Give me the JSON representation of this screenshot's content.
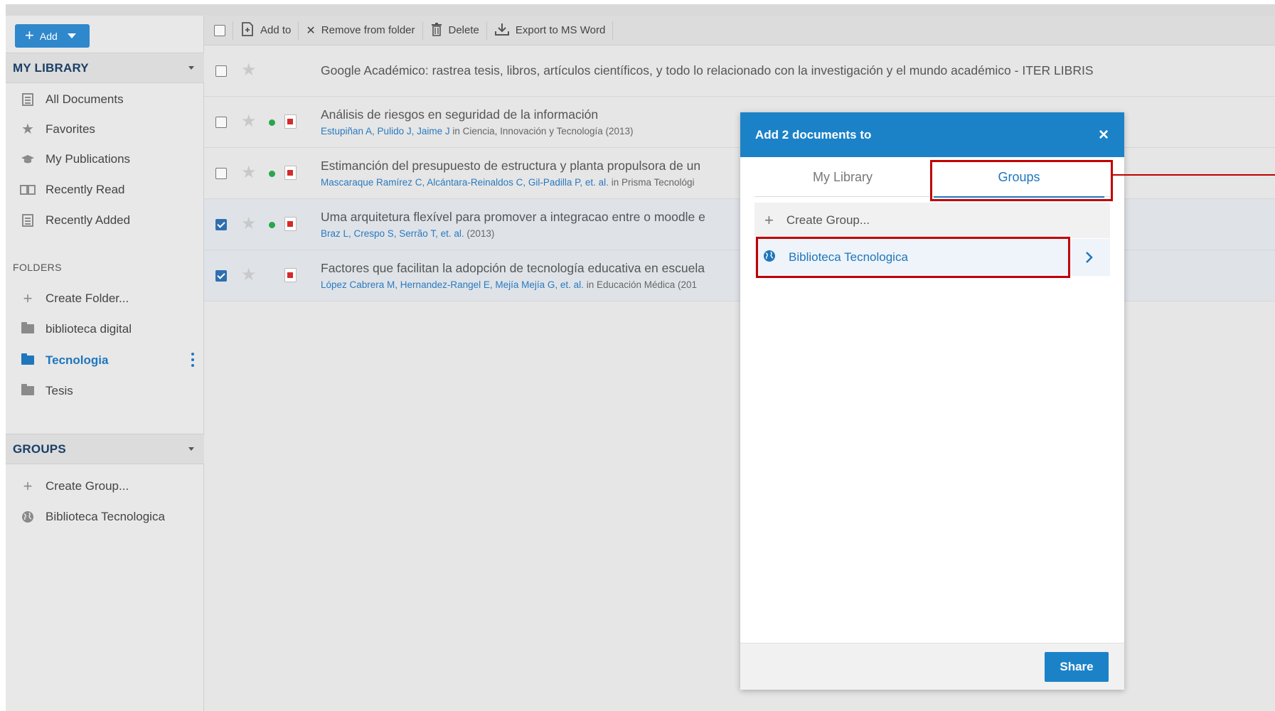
{
  "sidebar": {
    "add_label": "Add",
    "my_library": {
      "title": "MY LIBRARY",
      "items": [
        {
          "label": "All Documents",
          "icon": "documents-icon"
        },
        {
          "label": "Favorites",
          "icon": "star-icon"
        },
        {
          "label": "My Publications",
          "icon": "graduation-cap-icon"
        },
        {
          "label": "Recently Read",
          "icon": "book-icon"
        },
        {
          "label": "Recently Added",
          "icon": "documents-icon"
        }
      ]
    },
    "folders": {
      "title": "FOLDERS",
      "items": [
        {
          "label": "Create Folder...",
          "icon": "plus-icon"
        },
        {
          "label": "biblioteca digital",
          "icon": "folder-icon"
        },
        {
          "label": "Tecnologia",
          "icon": "folder-open-icon",
          "active": true
        },
        {
          "label": "Tesis",
          "icon": "folder-icon"
        }
      ]
    },
    "groups": {
      "title": "GROUPS",
      "items": [
        {
          "label": "Create Group...",
          "icon": "plus-icon"
        },
        {
          "label": "Biblioteca Tecnologica",
          "icon": "globe-icon"
        }
      ]
    }
  },
  "toolbar": {
    "add_to": "Add to",
    "remove": "Remove from folder",
    "delete": "Delete",
    "export": "Export to MS Word"
  },
  "documents": [
    {
      "title": "Google Académico: rastrea tesis, libros, artículos científicos, y todo lo relacionado con la investigación y el mundo académico - ITER LIBRIS",
      "authors": "",
      "source": "",
      "checked": false
    },
    {
      "title": "Análisis de riesgos en seguridad de la información",
      "authors": "Estupiñan A, Pulido J, Jaime J",
      "source": " in Ciencia, Innovación y Tecnología (2013)",
      "checked": false
    },
    {
      "title": "Estimanción del presupuesto de estructura y planta propulsora de un",
      "authors": "Mascaraque Ramírez C, Alcántara-Reinaldos C, Gil-Padilla P, et. al.",
      "source": " in Prisma Tecnológi",
      "checked": false
    },
    {
      "title": "Uma arquitetura flexível para promover a integracao entre o moodle e",
      "authors": "Braz L, Crespo S, Serrão T, et. al.",
      "source": " (2013)",
      "checked": true
    },
    {
      "title": "Factores que facilitan la adopción de tecnología educativa en escuela",
      "authors": "López Cabrera M, Hernandez-Rangel E, Mejía Mejía G, et. al.",
      "source": " in Educación Médica (201",
      "checked": true
    }
  ],
  "modal": {
    "title": "Add 2 documents to",
    "close": "×",
    "tab_library": "My Library",
    "tab_groups": "Groups",
    "create_group": "Create Group...",
    "group_name": "Biblioteca Tecnologica",
    "share": "Share"
  },
  "colors": {
    "accent": "#1c82c8",
    "highlight": "#c00000",
    "link": "#1f76bc"
  }
}
